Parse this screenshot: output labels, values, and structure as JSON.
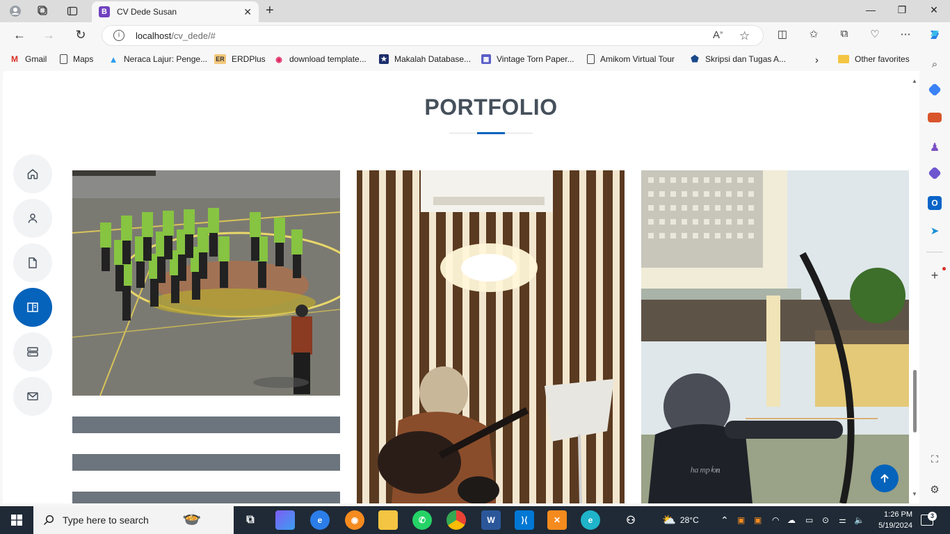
{
  "browser": {
    "tab_title": "CV Dede Susan",
    "tab_favicon": "B",
    "url_host": "localhost",
    "url_path": "/cv_dede/#"
  },
  "bookmarks": [
    {
      "label": "Gmail",
      "icon": "gmail-icon"
    },
    {
      "label": "Maps",
      "icon": "page-icon"
    },
    {
      "label": "Neraca Lajur: Penge...",
      "icon": "app-icon"
    },
    {
      "label": "ERDPlus",
      "icon": "erdplus-icon"
    },
    {
      "label": "download template...",
      "icon": "site-icon"
    },
    {
      "label": "Makalah Database...",
      "icon": "star-badge-icon"
    },
    {
      "label": "Vintage Torn Paper...",
      "icon": "site-icon"
    },
    {
      "label": "Amikom Virtual Tour",
      "icon": "page-icon"
    },
    {
      "label": "Skripsi dan Tugas A...",
      "icon": "site-icon"
    },
    {
      "label": "Other favorites",
      "icon": "folder-icon"
    }
  ],
  "page": {
    "section_title": "PORTFOLIO",
    "nav_items": [
      {
        "name": "home",
        "icon": "home-icon",
        "active": false
      },
      {
        "name": "about",
        "icon": "person-icon",
        "active": false
      },
      {
        "name": "resume",
        "icon": "file-icon",
        "active": false
      },
      {
        "name": "portfolio",
        "icon": "book-icon",
        "active": true
      },
      {
        "name": "services",
        "icon": "server-icon",
        "active": false
      },
      {
        "name": "contact",
        "icon": "envelope-icon",
        "active": false
      }
    ]
  },
  "taskbar": {
    "search_placeholder": "Type here to search",
    "weather": "28°C",
    "time": "1:26 PM",
    "date": "5/19/2024",
    "notification_count": "3"
  }
}
